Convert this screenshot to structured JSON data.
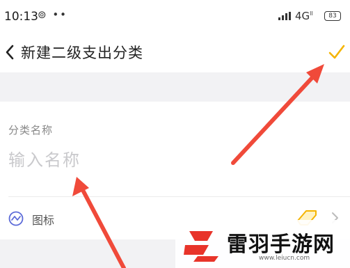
{
  "status_bar": {
    "time": "10:13",
    "notification_icons": "⊚ ••",
    "network": "4G",
    "network_sub": "ll",
    "battery": "83"
  },
  "nav": {
    "title": "新建二级支出分类",
    "back_icon": "chevron-left-icon",
    "confirm_icon": "check-icon",
    "accent_color": "#f5b400"
  },
  "form": {
    "name_label": "分类名称",
    "name_placeholder": "输入名称",
    "name_value": "",
    "icon_label": "图标",
    "icon_row_icon": "trend-circle-icon",
    "icon_preview": "tag-icon"
  },
  "annotations": {
    "arrow_color": "#f04a3a"
  },
  "watermark": {
    "brand": "雷羽手游网",
    "url": "www.leiucn.com",
    "logo_color": "#e8342a"
  }
}
